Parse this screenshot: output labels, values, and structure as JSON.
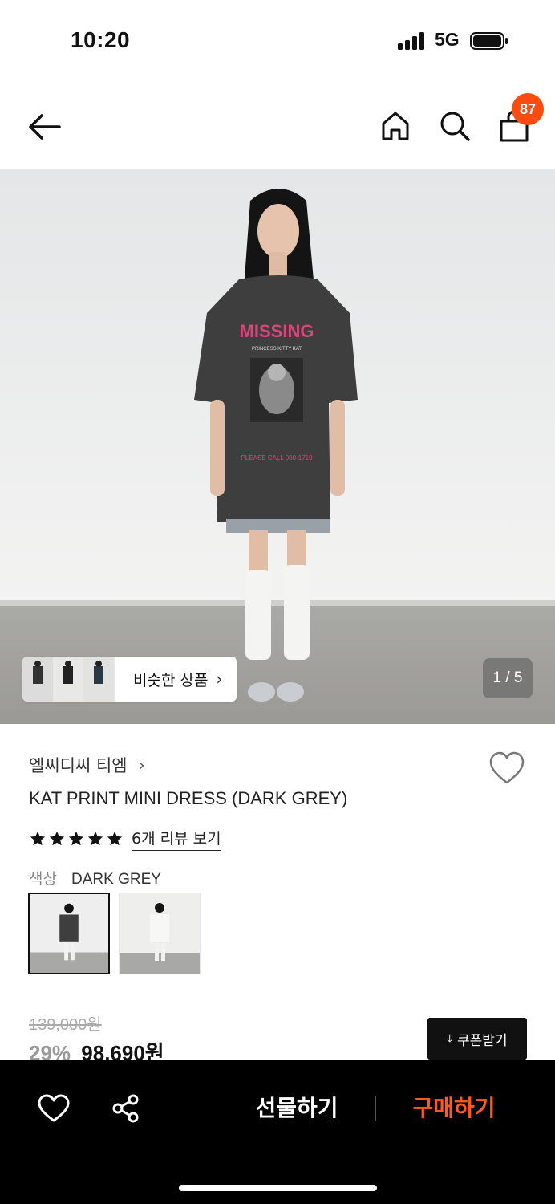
{
  "status_bar": {
    "time": "10:20",
    "network": "5G"
  },
  "nav": {
    "back_icon": "arrow-left-icon",
    "home_icon": "home-icon",
    "search_icon": "search-icon",
    "cart_icon": "shopping-bag-icon",
    "cart_count": "87"
  },
  "gallery": {
    "similar_label": "비슷한 상품",
    "page_indicator": "1 / 5",
    "print_title": "MISSING",
    "print_subtitle": "PRINCESS KITTY KAT",
    "print_call": "PLEASE CALL 080-1710"
  },
  "product": {
    "brand": "엘씨디씨 티엠",
    "name": "KAT PRINT MINI DRESS (DARK GREY)",
    "rating": 5,
    "review_link": "6개 리뷰 보기",
    "color_label": "색상",
    "color_value": "DARK GREY",
    "original_price": "139,000원",
    "discount_rate": "29%",
    "sale_price": "98,690원",
    "coupon_label": "쿠폰받기"
  },
  "bottom_bar": {
    "gift_label": "선물하기",
    "buy_label": "구매하기"
  },
  "colors": {
    "accent": "#ff4a10",
    "buy_text": "#ff5a1f",
    "bottom_bar_bg": "#000000"
  }
}
